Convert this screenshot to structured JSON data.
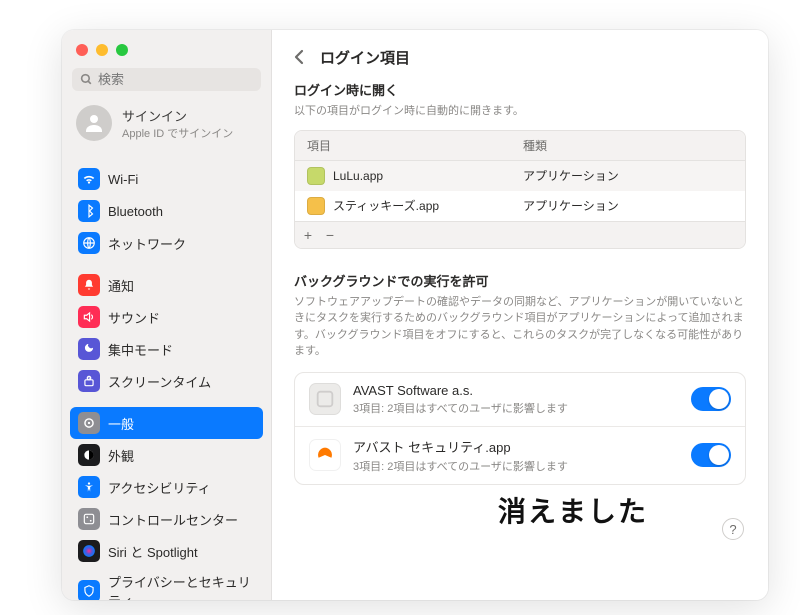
{
  "search": {
    "placeholder": "検索"
  },
  "account": {
    "line1": "サインイン",
    "line2": "Apple ID でサインイン"
  },
  "sidebar": {
    "groups": [
      [
        {
          "icon": "wifi",
          "bg": "#0a7aff",
          "label": "Wi-Fi"
        },
        {
          "icon": "bluetooth",
          "bg": "#0a7aff",
          "label": "Bluetooth"
        },
        {
          "icon": "network",
          "bg": "#0a7aff",
          "label": "ネットワーク"
        }
      ],
      [
        {
          "icon": "bell",
          "bg": "#ff3b30",
          "label": "通知"
        },
        {
          "icon": "sound",
          "bg": "#ff2d55",
          "label": "サウンド"
        },
        {
          "icon": "focus",
          "bg": "#5856d6",
          "label": "集中モード"
        },
        {
          "icon": "screentime",
          "bg": "#5856d6",
          "label": "スクリーンタイム"
        }
      ],
      [
        {
          "icon": "general",
          "bg": "#8e8e93",
          "label": "一般",
          "active": true
        },
        {
          "icon": "appearance",
          "bg": "#1c1c1e",
          "label": "外観"
        },
        {
          "icon": "accessibility",
          "bg": "#0a7aff",
          "label": "アクセシビリティ"
        },
        {
          "icon": "controlcenter",
          "bg": "#8e8e93",
          "label": "コントロールセンター"
        },
        {
          "icon": "siri",
          "bg": "#1c1c1e",
          "label": "Siri と Spotlight"
        },
        {
          "icon": "privacy",
          "bg": "#0a7aff",
          "label": "プライバシーとセキュリティ"
        }
      ]
    ]
  },
  "header": {
    "title": "ログイン項目"
  },
  "login": {
    "heading": "ログイン時に開く",
    "sub": "以下の項目がログイン時に自動的に開きます。",
    "cols": {
      "c1": "項目",
      "c2": "種類"
    },
    "rows": [
      {
        "icon_bg": "#c6d96a",
        "name": "LuLu.app",
        "kind": "アプリケーション"
      },
      {
        "icon_bg": "#f5c04a",
        "name": "スティッキーズ.app",
        "kind": "アプリケーション"
      }
    ],
    "add": "+",
    "remove": "−"
  },
  "bg": {
    "heading": "バックグラウンドでの実行を許可",
    "sub": "ソフトウェアアップデートの確認やデータの同期など、アプリケーションが開いていないときにタスクを実行するためのバックグラウンド項目がアプリケーションによって追加されます。バックグラウンド項目をオフにすると、これらのタスクが完了しなくなる可能性があります。",
    "items": [
      {
        "icon_bg": "#ecebe9",
        "icon_fg": "#cfcdcc",
        "name": "AVAST Software a.s.",
        "sub": "3項目: 2項目はすべてのユーザに影響します",
        "on": true
      },
      {
        "icon_bg": "#ffffff",
        "icon_fg": "#ff7a00",
        "name": "アバスト セキュリティ.app",
        "sub": "3項目: 2項目はすべてのユーザに影響します",
        "on": true
      }
    ]
  },
  "annotation": "消えました",
  "help": "?"
}
